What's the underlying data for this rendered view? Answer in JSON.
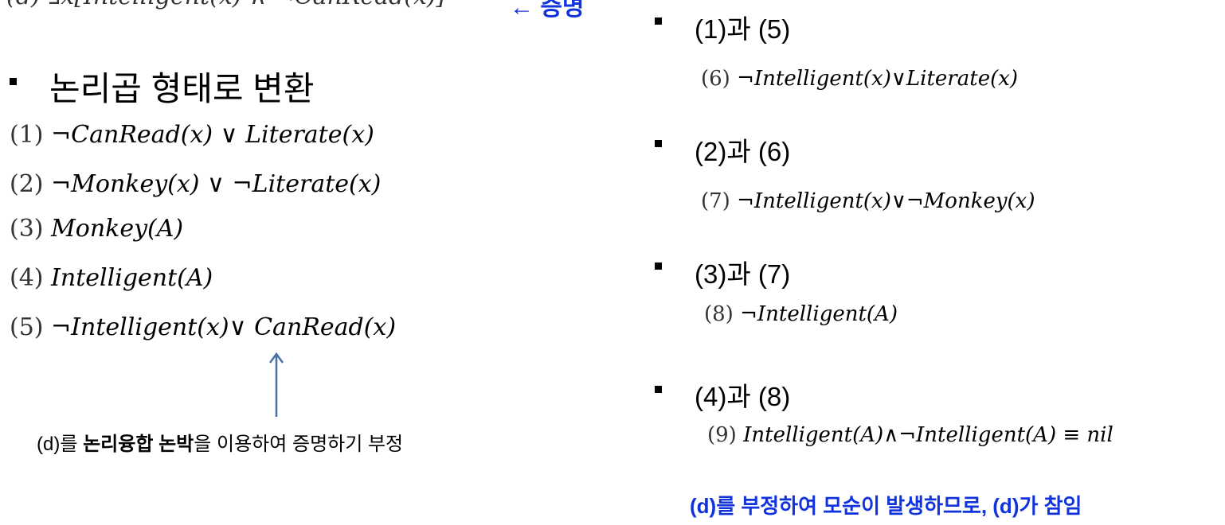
{
  "top_clipped": {
    "formula": "(d) ∃x[Intelligent(x) ∧ ¬CanRead(x)]",
    "note": "← 증명"
  },
  "left": {
    "heading": "논리곱 형태로 변환",
    "clauses": [
      {
        "num": "(1)",
        "text": "¬CanRead(x) ∨ Literate(x)"
      },
      {
        "num": "(2)",
        "text": "¬Monkey(x) ∨ ¬Literate(x)"
      },
      {
        "num": "(3)",
        "text": "Monkey(A)"
      },
      {
        "num": "(4)",
        "text": "Intelligent(A)"
      },
      {
        "num": "(5)",
        "text": "¬Intelligent(x)∨ CanRead(x)"
      }
    ],
    "caption_pre": "(d)를 ",
    "caption_bold": "논리융합 논박",
    "caption_post": "을 이용하여 증명하기 부정"
  },
  "right": {
    "steps": [
      {
        "head": "(1)과 (5)",
        "num": "(6)",
        "text": "¬Intelligent(x)∨Literate(x)"
      },
      {
        "head": "(2)과 (6)",
        "num": "(7)",
        "text": "¬Intelligent(x)∨¬Monkey(x)"
      },
      {
        "head": "(3)과 (7)",
        "num": "(8)",
        "text": "¬Intelligent(A)"
      },
      {
        "head": "(4)과 (8)",
        "num": "(9)",
        "text": "Intelligent(A)∧¬Intelligent(A) ≡ nil"
      }
    ],
    "conclusion": "(d)를 부정하여 모순이 발생하므로, (d)가 참임"
  },
  "colors": {
    "accent_blue": "#1133dd",
    "arrow": "#4a6fa5"
  }
}
